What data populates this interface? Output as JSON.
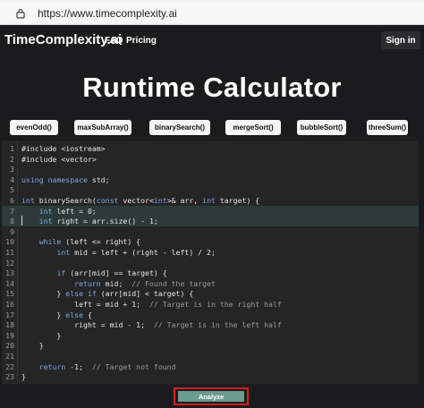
{
  "browser": {
    "url": "https://www.timecomplexity.ai"
  },
  "nav": {
    "brand": "TimeComplexity.ai",
    "links": [
      "FAQ",
      "Pricing"
    ],
    "signin": "Sign in"
  },
  "hero": {
    "title": "Runtime Calculator"
  },
  "examples": [
    "evenOdd()",
    "maxSubArray()",
    "binarySearch()",
    "mergeSort()",
    "bubbleSort()",
    "threeSum()"
  ],
  "editor": {
    "lines": [
      "#include <iostream>",
      "#include <vector>",
      "",
      "using namespace std;",
      "",
      "int binarySearch(const vector<int>& arr, int target) {",
      "    int left = 0;",
      "    int right = arr.size() - 1;",
      "",
      "    while (left <= right) {",
      "        int mid = left + (right - left) / 2;",
      "",
      "        if (arr[mid] == target) {",
      "            return mid;  // Found the target",
      "        } else if (arr[mid] < target) {",
      "            left = mid + 1;  // Target is in the right half",
      "        } else {",
      "            right = mid - 1;  // Target is in the left half",
      "        }",
      "    }",
      "",
      "    return -1;  // Target not found",
      "}"
    ]
  },
  "analyze": {
    "label": "Analyze"
  },
  "colors": {
    "accent_button": "#6b9c8e",
    "highlight_box": "#e21b1b",
    "keyword": "#7aa7e8"
  }
}
